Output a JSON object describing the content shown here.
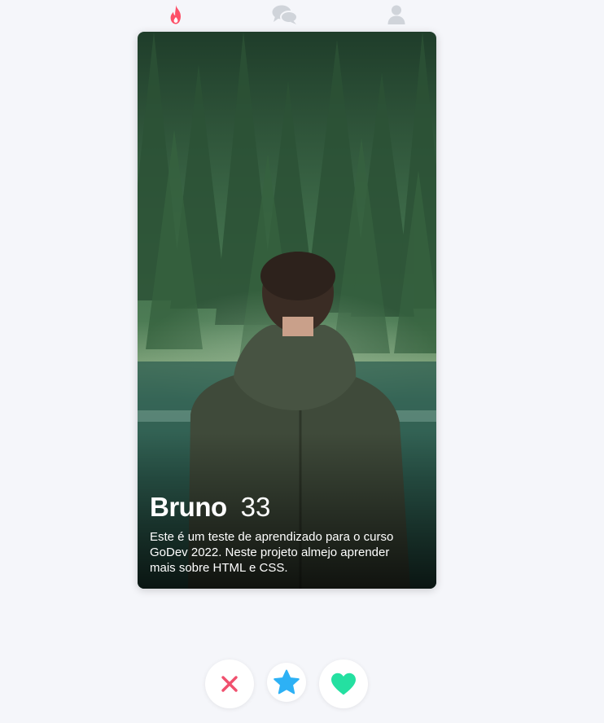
{
  "nav": {
    "items": [
      {
        "icon": "flame-icon",
        "color": "#fd5068",
        "active": true
      },
      {
        "icon": "chat-bubbles-icon",
        "color": "#d0d4da",
        "active": false
      },
      {
        "icon": "user-icon",
        "color": "#d0d4da",
        "active": false
      }
    ]
  },
  "profile": {
    "name": "Bruno",
    "age": "33",
    "bio": "Este é um teste de aprendizado para o curso GoDev 2022. Neste projeto almejo aprender mais sobre HTML e CSS."
  },
  "actions": [
    {
      "icon": "close-icon",
      "color": "#f0506e"
    },
    {
      "icon": "star-icon",
      "color": "#2db1f5"
    },
    {
      "icon": "heart-icon",
      "color": "#24e0a1"
    }
  ]
}
